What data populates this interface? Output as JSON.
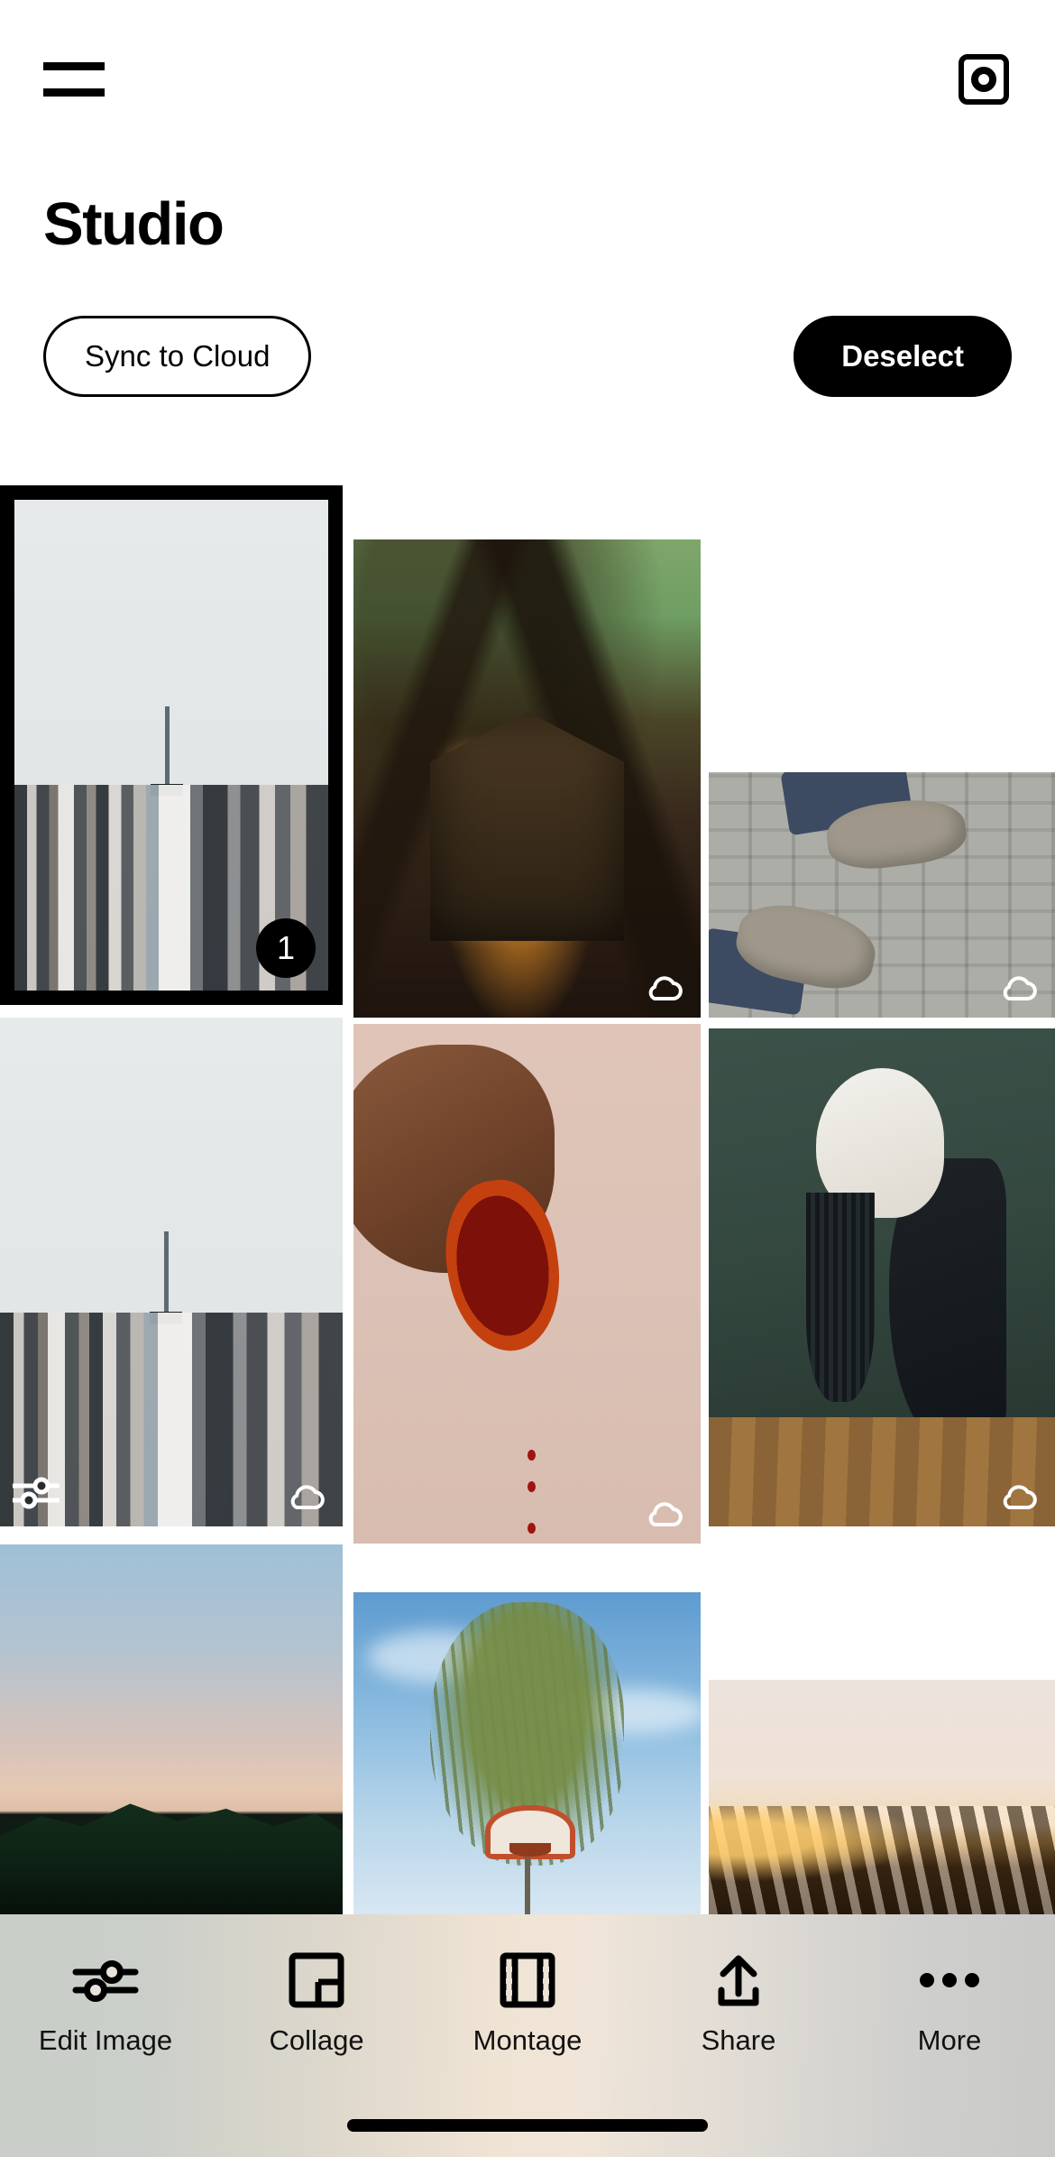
{
  "header": {
    "menu_icon": "hamburger-menu-icon",
    "camera_icon": "camera-icon",
    "title": "Studio"
  },
  "actions": {
    "sync_label": "Sync to Cloud",
    "deselect_label": "Deselect"
  },
  "grid": {
    "selected_badge": "1",
    "cloud_icon": "cloud-icon",
    "sliders_icon": "sliders-icon",
    "tiles": [
      {
        "name": "photo-city-skyline-selected",
        "selected": true,
        "badge": "1",
        "cloud": false,
        "edited": false
      },
      {
        "name": "photo-green-house-night",
        "selected": false,
        "badge": null,
        "cloud": true,
        "edited": false
      },
      {
        "name": "photo-shoes-cobblestone",
        "selected": false,
        "badge": null,
        "cloud": true,
        "edited": false
      },
      {
        "name": "photo-city-skyline-edited",
        "selected": false,
        "badge": null,
        "cloud": true,
        "edited": true
      },
      {
        "name": "photo-hand-blood-orange",
        "selected": false,
        "badge": null,
        "cloud": true,
        "edited": false
      },
      {
        "name": "photo-dancer-flowers",
        "selected": false,
        "badge": null,
        "cloud": true,
        "edited": false
      },
      {
        "name": "photo-mountain-dusk",
        "selected": false,
        "badge": null,
        "cloud": false,
        "edited": false
      },
      {
        "name": "photo-basketball-hoop-tree",
        "selected": false,
        "badge": null,
        "cloud": false,
        "edited": false
      },
      {
        "name": "photo-golden-waves",
        "selected": false,
        "badge": null,
        "cloud": false,
        "edited": false
      }
    ]
  },
  "toolbar": {
    "items": [
      {
        "label": "Edit Image",
        "icon": "sliders-icon"
      },
      {
        "label": "Collage",
        "icon": "collage-icon"
      },
      {
        "label": "Montage",
        "icon": "film-strip-icon"
      },
      {
        "label": "Share",
        "icon": "share-upload-icon"
      },
      {
        "label": "More",
        "icon": "ellipsis-icon"
      }
    ]
  },
  "colors": {
    "accent": "#000000",
    "background": "#ffffff",
    "toolbar_tint": "#efe3d4"
  }
}
